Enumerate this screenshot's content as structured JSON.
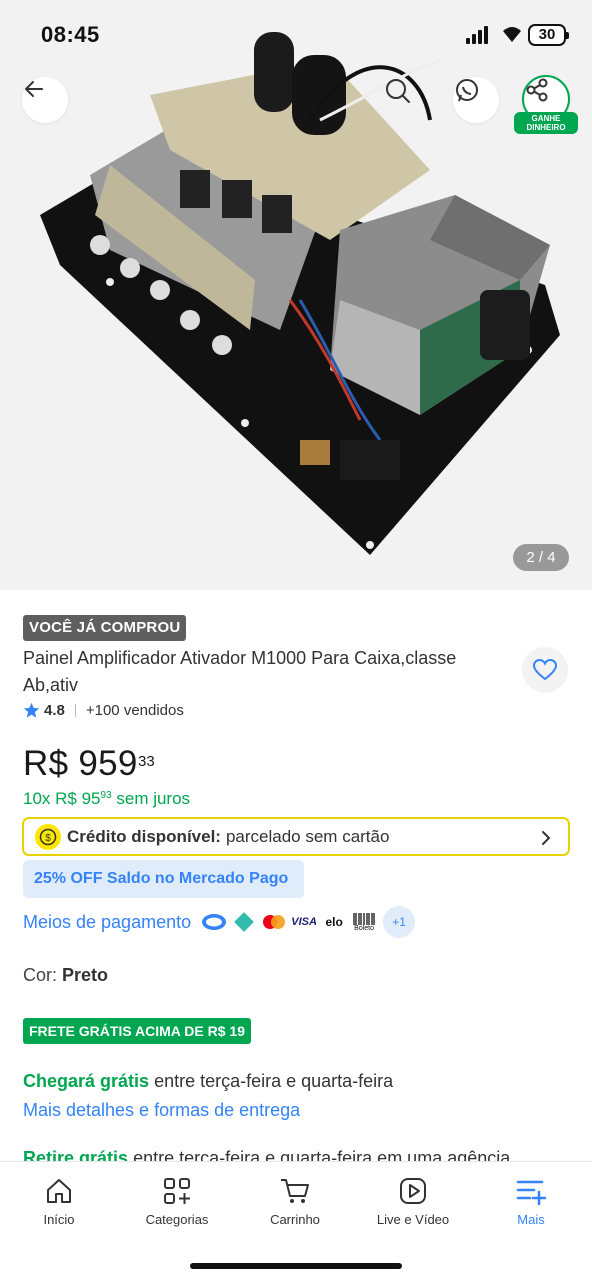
{
  "status_bar": {
    "time": "08:45",
    "battery": "30"
  },
  "hero": {
    "page_indicator": "2 / 4",
    "share_tag": "GANHE DINHEIRO"
  },
  "product": {
    "bought_badge": "VOCÊ JÁ COMPROU",
    "title": "Painel Amplificador Ativador M1000 Para Caixa,classe Ab,ativ",
    "rating": "4.8",
    "sold": "+100 vendidos",
    "price_main": "R$ 959",
    "price_cents": "33",
    "installments_prefix": "10x R$ 95",
    "installments_cents": "93",
    "installments_suffix": "sem juros",
    "credit_bold": "Crédito disponível:",
    "credit_text": "parcelado sem cartão",
    "off_badge": "25% OFF Saldo no Mercado Pago",
    "payment_link": "Meios de pagamento",
    "payment_more": "+1",
    "color_label": "Cor:",
    "color_value": "Preto",
    "frete_badge": "FRETE GRÁTIS ACIMA DE R$ 19",
    "delivery_green": "Chegará grátis",
    "delivery_text": "entre terça-feira e quarta-feira",
    "delivery_link": "Mais detalhes e formas de entrega",
    "pickup_green": "Retire grátis",
    "pickup_text": "entre terça-feira e quarta-feira em uma agência"
  },
  "payment_icons": [
    "visa-card-icon",
    "pix-icon",
    "mastercard-icon",
    "visa-icon",
    "elo-icon",
    "boleto-icon"
  ],
  "payment_icon_labels": {
    "visa": "VISA",
    "elo": "elo",
    "boleto": "Boleto"
  },
  "bottom_nav": [
    {
      "label": "Início",
      "icon": "home-icon"
    },
    {
      "label": "Categorias",
      "icon": "categories-icon"
    },
    {
      "label": "Carrinho",
      "icon": "cart-icon"
    },
    {
      "label": "Live e Vídeo",
      "icon": "video-icon"
    },
    {
      "label": "Mais",
      "icon": "menu-plus-icon",
      "active": true
    }
  ],
  "colors": {
    "accent_blue": "#3483fa",
    "green": "#00a650",
    "yellow": "#ffe600"
  }
}
